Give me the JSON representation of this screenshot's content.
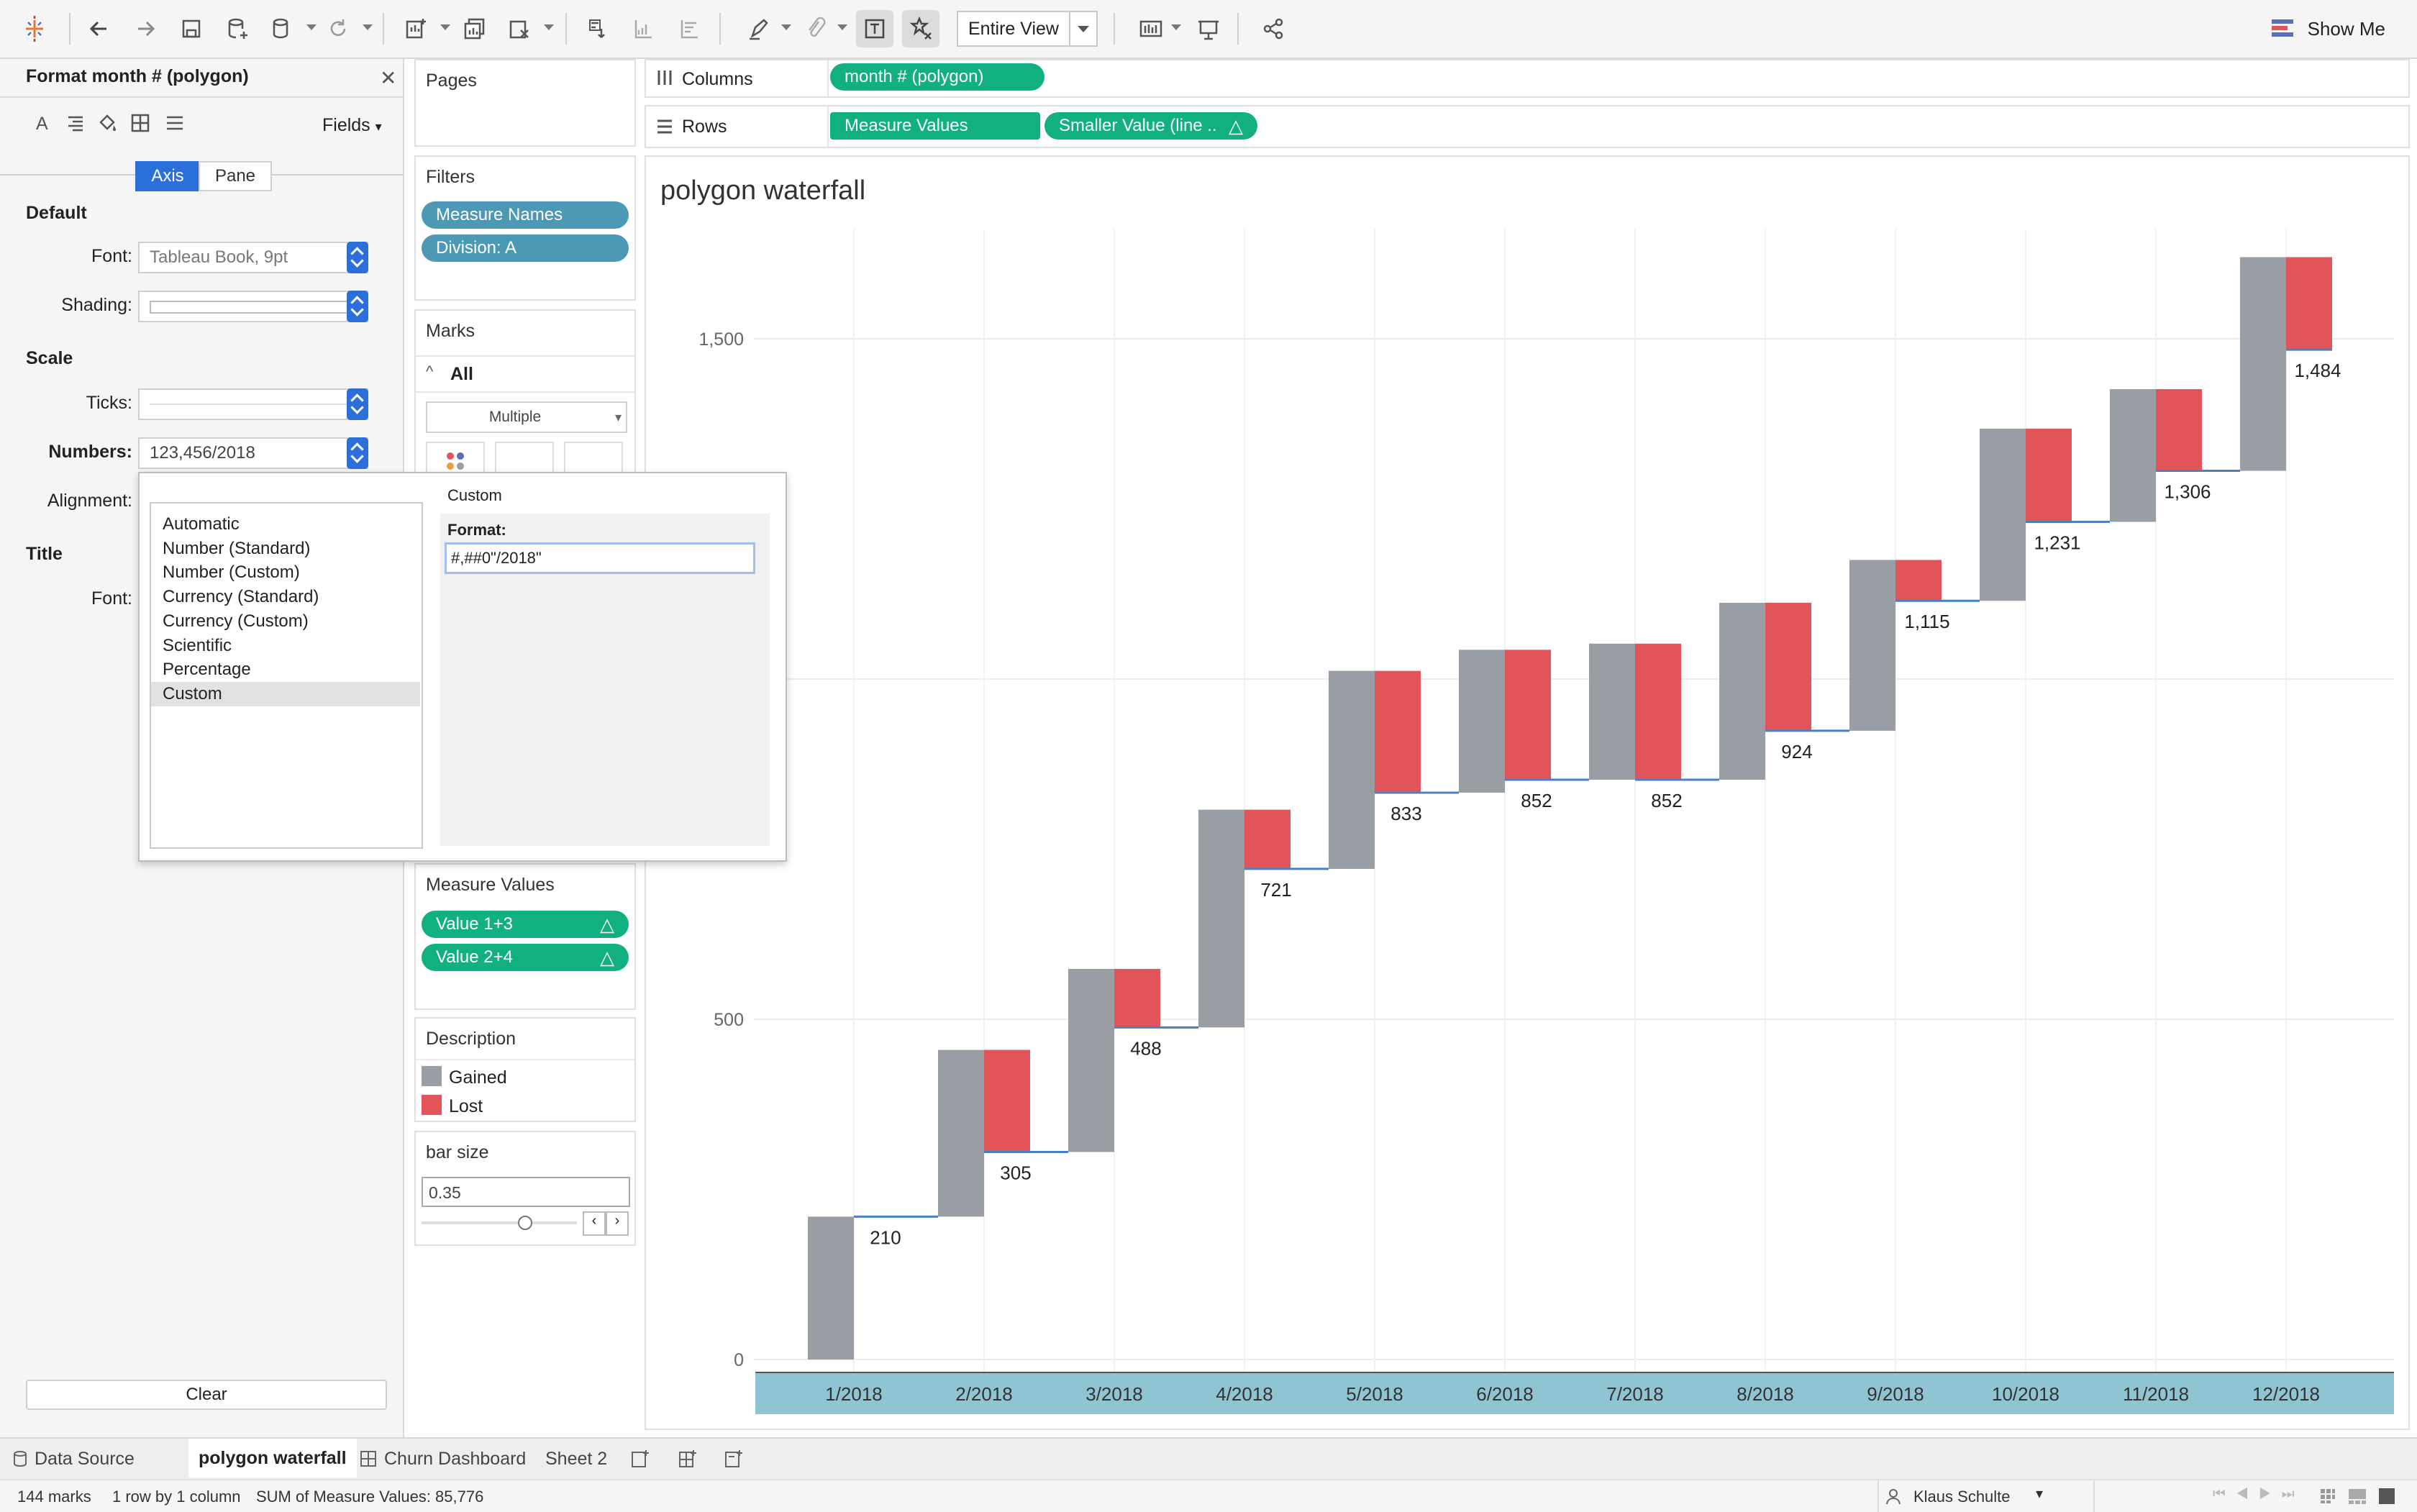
{
  "toolbar": {
    "view_select": "Entire View",
    "show_me": "Show Me"
  },
  "format_pane": {
    "title": "Format month # (polygon)",
    "fields_label": "Fields",
    "tabs": [
      "Axis",
      "Pane"
    ],
    "sections": {
      "default": "Default",
      "scale": "Scale",
      "title": "Title"
    },
    "labels": {
      "font": "Font:",
      "shading": "Shading:",
      "ticks": "Ticks:",
      "numbers": "Numbers:",
      "alignment": "Alignment:",
      "title_font": "Font:"
    },
    "values": {
      "font": "Tableau Book, 9pt",
      "numbers": "123,456/2018"
    },
    "clear_button": "Clear"
  },
  "number_popup": {
    "options": [
      "Automatic",
      "Number (Standard)",
      "Number (Custom)",
      "Currency (Standard)",
      "Currency (Custom)",
      "Scientific",
      "Percentage",
      "Custom"
    ],
    "selected": "Custom",
    "heading": "Custom",
    "format_label": "Format:",
    "format_value": "#,##0\"/2018\""
  },
  "shelves": {
    "pages": "Pages",
    "filters": "Filters",
    "filter_pills": [
      "Measure Names",
      "Division: A"
    ],
    "marks": "Marks",
    "marks_all": "All",
    "mark_type": "Multiple",
    "columns_label": "Columns",
    "rows_label": "Rows",
    "columns_pill": "month # (polygon)",
    "rows_pills": [
      "Measure Values",
      "Smaller Value (line .."
    ],
    "measure_values": "Measure Values",
    "measure_value_pills": [
      "Value 1+3",
      "Value 2+4"
    ],
    "legend_title": "Description",
    "legend": [
      {
        "label": "Gained",
        "color": "#999ea4"
      },
      {
        "label": "Lost",
        "color": "#e0545a"
      }
    ],
    "param_title": "bar size",
    "param_value": "0.35"
  },
  "chart_data": {
    "type": "bar",
    "title": "polygon waterfall",
    "categories": [
      "1/2018",
      "2/2018",
      "3/2018",
      "4/2018",
      "5/2018",
      "6/2018",
      "7/2018",
      "8/2018",
      "9/2018",
      "10/2018",
      "11/2018",
      "12/2018"
    ],
    "series": [
      {
        "name": "Gained",
        "color": "#999ea4",
        "start": [
          0,
          210,
          305,
          488,
          721,
          833,
          852,
          852,
          924,
          1115,
          1231,
          1306
        ],
        "end": [
          210,
          455,
          574,
          808,
          1012,
          1043,
          1052,
          1112,
          1175,
          1368,
          1426,
          1620
        ]
      },
      {
        "name": "Lost",
        "color": "#e0545a",
        "start": [
          210,
          305,
          488,
          721,
          833,
          852,
          852,
          924,
          1115,
          1231,
          1306,
          1484
        ],
        "end": [
          210,
          455,
          574,
          808,
          1012,
          1043,
          1052,
          1112,
          1175,
          1368,
          1426,
          1620
        ]
      }
    ],
    "line_values": [
      210,
      305,
      488,
      721,
      833,
      852,
      852,
      924,
      1115,
      1231,
      1306,
      1484
    ],
    "data_labels": [
      "210",
      "305",
      "488",
      "721",
      "833",
      "852",
      "852",
      "924",
      "1,115",
      "1,231",
      "1,306",
      "1,484"
    ],
    "y_ticks": [
      0,
      500,
      1500
    ],
    "y_tick_labels": [
      "0",
      "500",
      "1,500"
    ],
    "ylim": [
      -15,
      1710
    ],
    "grid": true,
    "axis_band_color": "#8fc4d2"
  },
  "tabs": {
    "data_source": "Data Source",
    "sheets": [
      "polygon waterfall",
      "Churn Dashboard",
      "Sheet 2"
    ],
    "active": "polygon waterfall"
  },
  "status": {
    "marks": "144 marks",
    "rows_cols": "1 row by 1 column",
    "sum": "SUM of Measure Values: 85,776",
    "user": "Klaus Schulte"
  }
}
